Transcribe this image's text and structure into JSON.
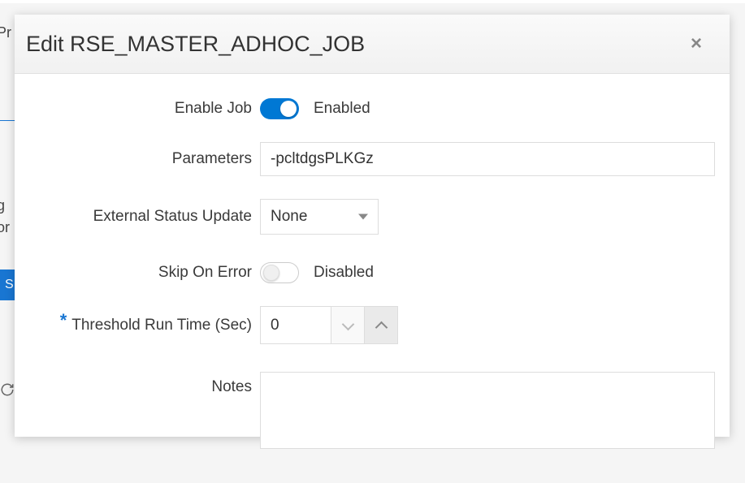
{
  "dialog": {
    "title": "Edit RSE_MASTER_ADHOC_JOB",
    "fields": {
      "enableJob": {
        "label": "Enable Job",
        "stateLabel": "Enabled"
      },
      "parameters": {
        "label": "Parameters",
        "value": "-pcltdgsPLKGz"
      },
      "externalStatusUpdate": {
        "label": "External Status Update",
        "value": "None"
      },
      "skipOnError": {
        "label": "Skip On Error",
        "stateLabel": "Disabled"
      },
      "thresholdRunTime": {
        "label": "Threshold Run Time (Sec)",
        "value": "0"
      },
      "notes": {
        "label": "Notes",
        "value": ""
      }
    }
  },
  "background": {
    "leftText1": "g",
    "leftText2": "or",
    "leftText3": "Pr",
    "btnInitial": "S"
  }
}
